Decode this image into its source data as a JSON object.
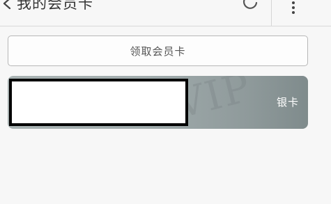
{
  "header": {
    "title": "我的会员卡",
    "back_icon": "chevron-left-icon",
    "refresh_icon": "refresh-icon",
    "more_icon": "more-vertical-icon"
  },
  "claim_button": {
    "label": "领取会员卡"
  },
  "card": {
    "watermark": "VIP",
    "level": "银卡",
    "colors": {
      "card_start": "#a9b3b3",
      "card_end": "#7f8b8c"
    }
  }
}
